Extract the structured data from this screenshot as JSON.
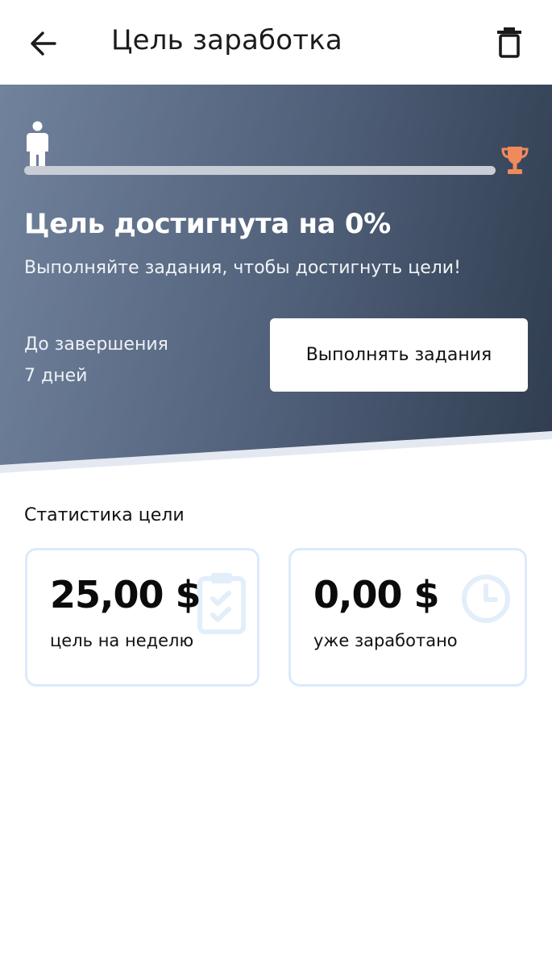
{
  "header": {
    "title": "Цель заработка",
    "back_icon": "arrow-left-icon",
    "delete_icon": "trash-icon"
  },
  "progress": {
    "percent": 0,
    "start_icon": "person-icon",
    "end_icon": "trophy-icon",
    "trophy_color": "#f08a5a"
  },
  "hero": {
    "heading": "Цель достигнута на 0%",
    "subtitle": "Выполняйте задания, чтобы достигнуть цели!",
    "until_label": "До завершения",
    "until_value": "7 дней",
    "cta_label": "Выполнять задания"
  },
  "stats": {
    "heading": "Статистика цели",
    "cards": [
      {
        "value": "25,00 $",
        "label": "цель на неделю",
        "icon": "clipboard-check-icon"
      },
      {
        "value": "0,00 $",
        "label": "уже заработано",
        "icon": "clock-icon"
      }
    ]
  },
  "colors": {
    "hero_gradient_start": "#71829d",
    "hero_gradient_end": "#303d50",
    "card_border": "#dbeafb",
    "icon_watermark": "#e3eefb"
  }
}
